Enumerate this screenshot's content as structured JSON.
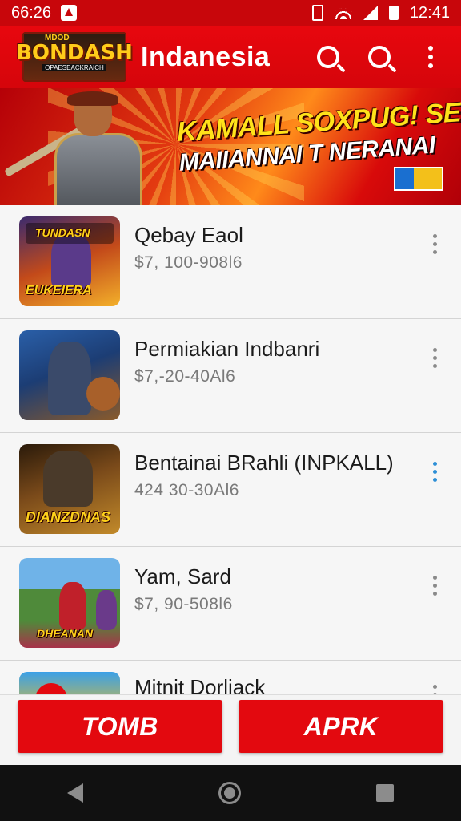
{
  "status_bar": {
    "time": "66:26",
    "clock": "12:41",
    "icons": [
      "notification-icon",
      "vibrate-icon",
      "wifi-icon",
      "signal-icon",
      "battery-icon"
    ]
  },
  "app_bar": {
    "logo_top": "MDOD",
    "logo_main": "BONDASH",
    "logo_sub": "OPAESEACKRAICH",
    "title": "Indanesia",
    "icons": [
      "search-icon",
      "search-icon",
      "more-vert-icon"
    ]
  },
  "banner": {
    "line1": "KAMALL SOXPUG! SEA!",
    "line2": "MAIIANNAI T NERANAI"
  },
  "items": [
    {
      "name": "Qebay Eaol",
      "price": "$7, 100-908l6",
      "thumb_caption": "EUKEIERA",
      "thumb_top": "TUNDASN"
    },
    {
      "name": "Permiakian Indbanri",
      "price": "$7,-20-40Al6",
      "thumb_caption": "",
      "thumb_top": ""
    },
    {
      "name": "Bentainai BRahli (INPKALL)",
      "price": "424  30-30Al6",
      "thumb_caption": "DIANZDNAS",
      "thumb_top": ""
    },
    {
      "name": "Yam, Sard",
      "price": "$7, 90-508l6",
      "thumb_caption": "DHEANAN",
      "thumb_top": ""
    },
    {
      "name": "Mitnit Dorliack",
      "price": "",
      "thumb_caption": "",
      "thumb_top": ""
    }
  ],
  "actions": {
    "primary": "TOMB",
    "secondary": "APRK"
  },
  "colors": {
    "brand_red": "#e3090f",
    "status_red": "#c8060b",
    "accent_blue": "#2d8fd6"
  }
}
